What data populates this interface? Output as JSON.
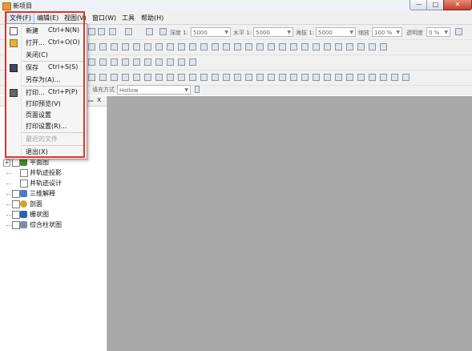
{
  "window": {
    "title": "新项目",
    "min": "—",
    "max": "□",
    "close": "✕"
  },
  "menubar": [
    "文件(F)",
    "编辑(E)",
    "视图(V)",
    "窗口(W)",
    "工具",
    "帮助(H)"
  ],
  "toolbar": {
    "fields": [
      {
        "label": "深度 1:",
        "value": "5000"
      },
      {
        "label": "水平 1:",
        "value": "5000"
      },
      {
        "label": "海拔 1:",
        "value": "5000"
      },
      {
        "label": "缩放",
        "value": "100 %"
      },
      {
        "label": "透明度",
        "value": "0 %"
      }
    ],
    "fill_label": "填充方式",
    "fill_value": "Hollow"
  },
  "panel": {
    "pin": "ꟷ",
    "close": "x"
  },
  "tree": [
    {
      "label": "平面图",
      "expander": "+",
      "icon_color": "#3f8f2c"
    },
    {
      "label": "井轨迹投影",
      "icon_color": ""
    },
    {
      "label": "井轨迹设计",
      "icon_color": ""
    },
    {
      "label": "三维解释",
      "icon_color": "#4a7cc9"
    },
    {
      "label": "剖面",
      "icon_color": "#d4a42a"
    },
    {
      "label": "栅状图",
      "icon_color": "#2f5fb0"
    },
    {
      "label": "综合柱状图",
      "icon_color": "#7a8fa6"
    }
  ],
  "file_menu": [
    {
      "label": "新建",
      "shortcut": "Ctrl+N(N)",
      "icon": "new-file-icon",
      "disabled": false
    },
    {
      "label": "打开...",
      "shortcut": "Ctrl+O(O)",
      "icon": "open-folder-icon",
      "disabled": false
    },
    {
      "label": "关闭(C)",
      "shortcut": "",
      "icon": "",
      "disabled": false
    },
    {
      "label": "保存",
      "shortcut": "Ctrl+S(S)",
      "icon": "save-icon",
      "disabled": false
    },
    {
      "label": "另存为(A)...",
      "shortcut": "",
      "icon": "",
      "disabled": false
    },
    {
      "label": "打印...",
      "shortcut": "Ctrl+P(P)",
      "icon": "print-icon",
      "disabled": false
    },
    {
      "label": "打印预览(V)",
      "shortcut": "",
      "icon": "",
      "disabled": false
    },
    {
      "label": "页面设置",
      "shortcut": "",
      "icon": "",
      "disabled": false
    },
    {
      "label": "打印设置(R)...",
      "shortcut": "",
      "icon": "",
      "disabled": false
    },
    {
      "label": "最近的文件",
      "shortcut": "",
      "icon": "",
      "disabled": true
    },
    {
      "label": "退出(X)",
      "shortcut": "",
      "icon": "",
      "disabled": false
    }
  ],
  "colors": {
    "highlight": "#e0342a",
    "workspace": "#a9a9a9"
  }
}
